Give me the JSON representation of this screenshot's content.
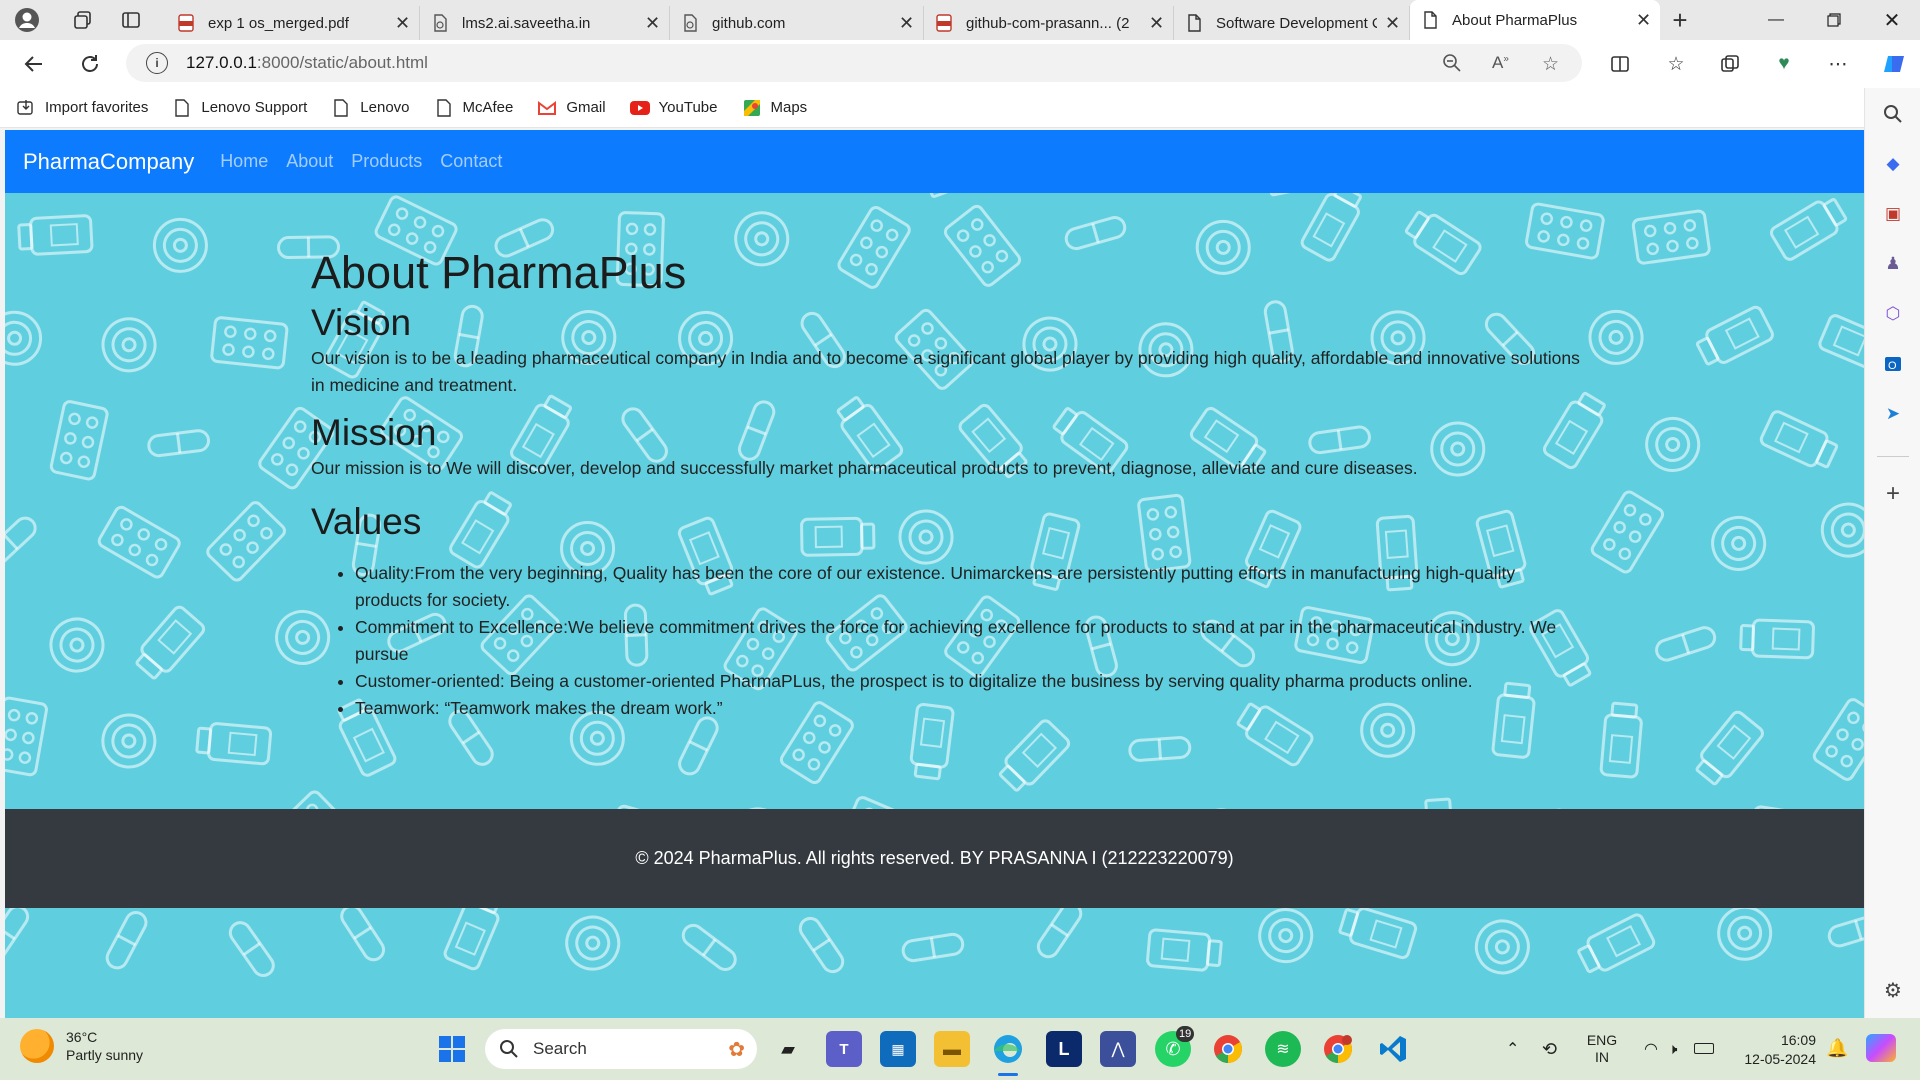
{
  "browser": {
    "tabs": [
      {
        "title": "exp 1 os_merged.pdf",
        "icon": "pdf-icon",
        "active": false
      },
      {
        "title": "lms2.ai.saveetha.in",
        "icon": "loading-page-icon",
        "active": false
      },
      {
        "title": "github.com",
        "icon": "loading-page-icon",
        "active": false
      },
      {
        "title": "github-com-prasann... (2",
        "icon": "pdf-icon",
        "active": false
      },
      {
        "title": "Software Development C",
        "icon": "page-icon",
        "active": false
      },
      {
        "title": "About PharmaPlus",
        "icon": "page-icon",
        "active": true
      }
    ],
    "url_host": "127.0.0.1",
    "url_path": ":8000/static/about.html",
    "favorites": [
      {
        "label": "Import favorites",
        "icon": "import-icon"
      },
      {
        "label": "Lenovo Support",
        "icon": "page-icon"
      },
      {
        "label": "Lenovo",
        "icon": "page-icon"
      },
      {
        "label": "McAfee",
        "icon": "page-icon"
      },
      {
        "label": "Gmail",
        "icon": "gmail-icon"
      },
      {
        "label": "YouTube",
        "icon": "youtube-icon"
      },
      {
        "label": "Maps",
        "icon": "maps-icon"
      }
    ]
  },
  "site": {
    "brand": "PharmaCompany",
    "nav": [
      "Home",
      "About",
      "Products",
      "Contact"
    ],
    "title": "About PharmaPlus",
    "vision_heading": "Vision",
    "vision_text": "Our vision is to be a leading pharmaceutical company in India and to become a significant global player by providing high quality, affordable and innovative solutions in medicine and treatment.",
    "mission_heading": "Mission",
    "mission_text": "Our mission is to We will discover, develop and successfully market pharmaceutical products to prevent, diagnose, alleviate and cure diseases.",
    "values_heading": "Values",
    "values": [
      "Quality:From the very beginning, Quality has been the core of our existence. Unimarckens are persistently putting efforts in manufacturing high-quality products for society.",
      "Commitment to Excellence:We believe commitment drives the force for achieving excellence for products to stand at par in the pharmaceutical industry. We pursue",
      "Customer-oriented: Being a customer-oriented PharmaPLus, the prospect is to digitalize the business by serving quality pharma products online.",
      "Teamwork: “Teamwork makes the dream work.”"
    ],
    "footer": "© 2024 PharmaPlus. All rights reserved. BY PRASANNA I (212223220079)"
  },
  "taskbar": {
    "temperature": "36°C",
    "weather": "Partly sunny",
    "search_placeholder": "Search",
    "language_1": "ENG",
    "language_2": "IN",
    "time": "16:09",
    "date": "12-05-2024",
    "whatsapp_badge": "19"
  },
  "colors": {
    "navbar": "#0d7bfd",
    "page_background": "#5fcfdf",
    "footer": "#343a40"
  }
}
